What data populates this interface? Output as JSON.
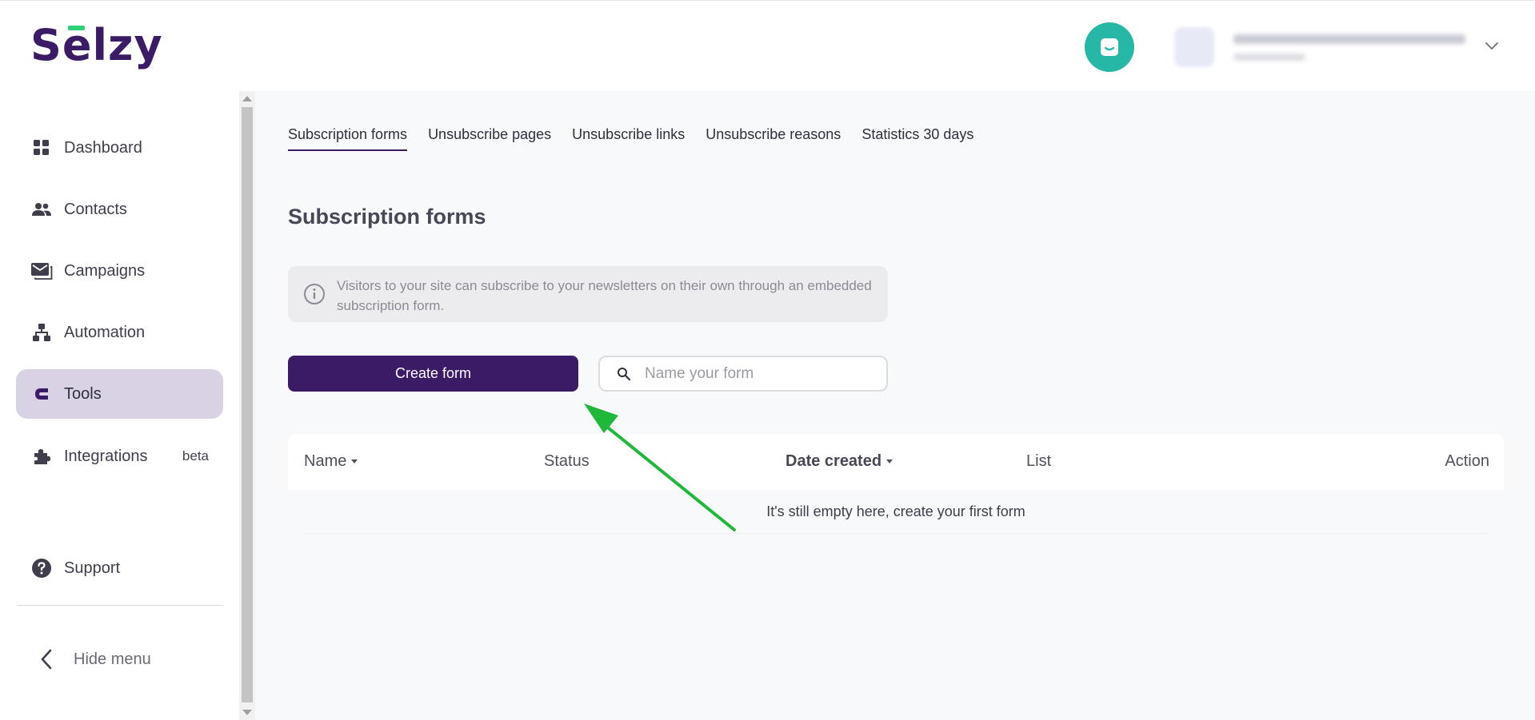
{
  "brand": {
    "name": "Selzy",
    "accent": "#3b1b66",
    "logo_mark": "#2fd07a"
  },
  "header": {
    "chat_icon": "chat-bubble-icon",
    "account_menu_icon": "chevron-down-icon"
  },
  "sidebar": {
    "items": [
      {
        "label": "Dashboard",
        "icon": "grid-icon"
      },
      {
        "label": "Contacts",
        "icon": "people-icon"
      },
      {
        "label": "Campaigns",
        "icon": "envelope-icon"
      },
      {
        "label": "Automation",
        "icon": "hierarchy-icon"
      },
      {
        "label": "Tools",
        "icon": "magnet-icon",
        "active": true
      },
      {
        "label": "Integrations",
        "icon": "puzzle-icon",
        "badge": "beta"
      }
    ],
    "support": "Support",
    "hide_menu": "Hide menu"
  },
  "tabs": [
    "Subscription forms",
    "Unsubscribe pages",
    "Unsubscribe links",
    "Unsubscribe reasons",
    "Statistics 30 days"
  ],
  "page_title": "Subscription forms",
  "info": "Visitors to your site can subscribe to your newsletters on their own through an embedded subscription form.",
  "create_button": "Create form",
  "search": {
    "placeholder": "Name your form",
    "value": ""
  },
  "table": {
    "columns": [
      "Name",
      "Status",
      "Date created",
      "List",
      "Action"
    ],
    "empty_text": "It's still empty here, create your first form"
  },
  "annotation_color": "#1fb83a"
}
